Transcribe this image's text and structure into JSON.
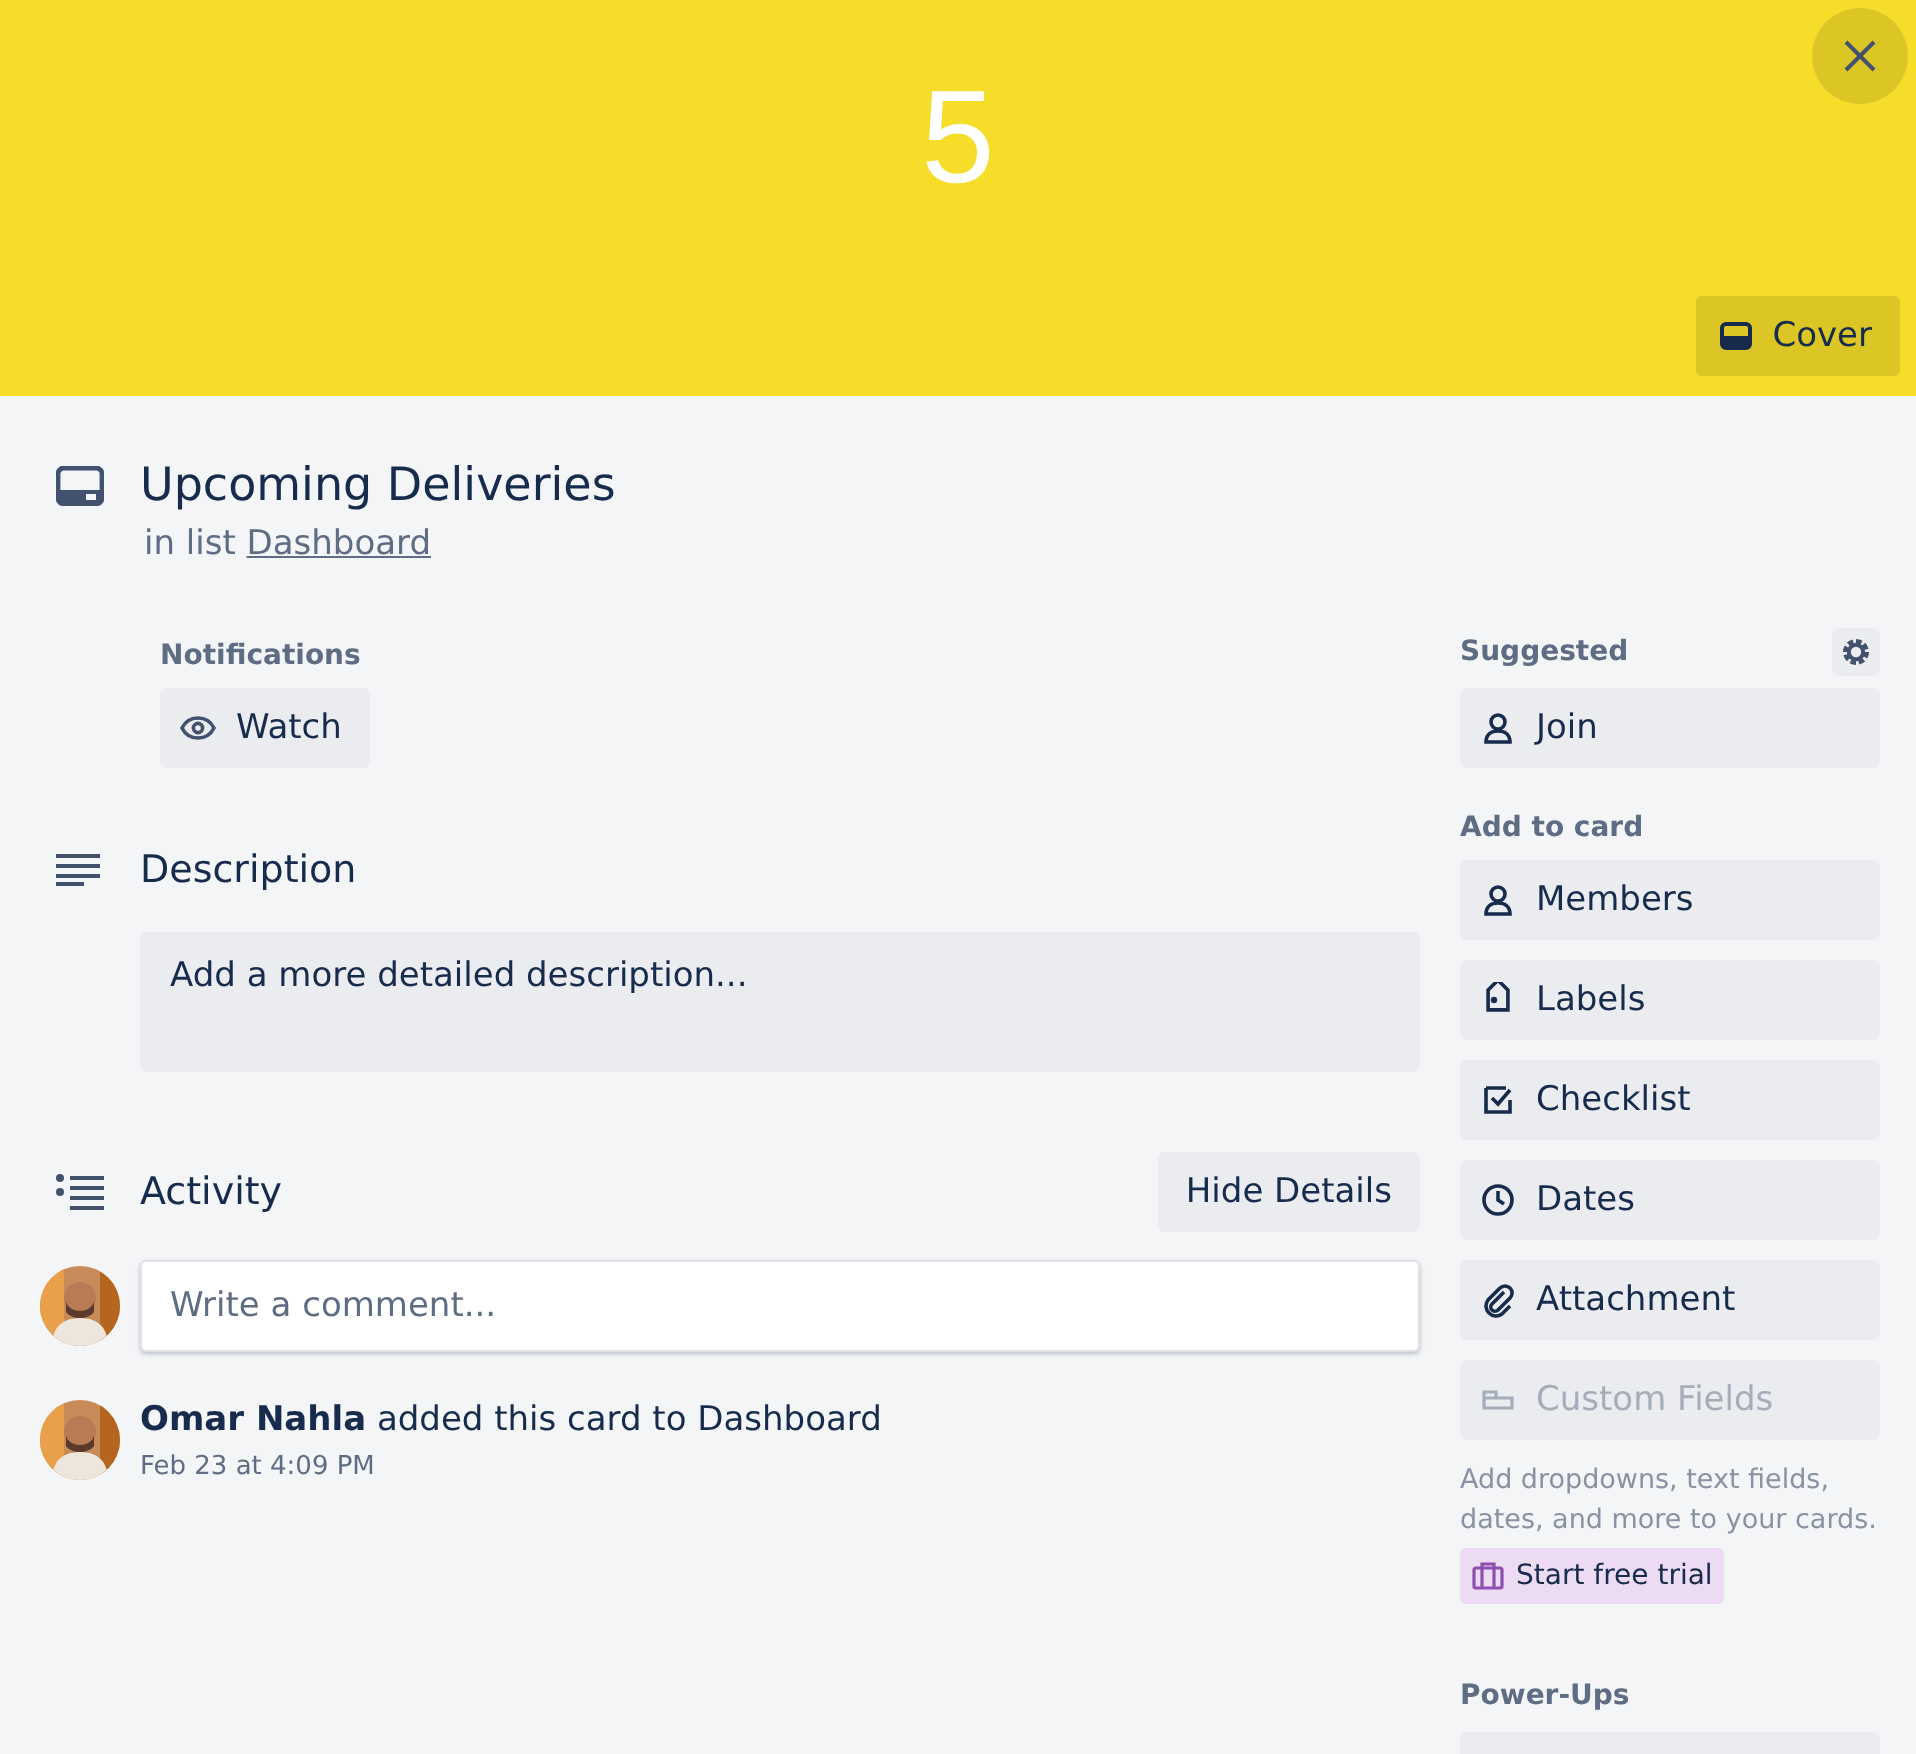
{
  "cover": {
    "title": "5",
    "cover_button": "Cover"
  },
  "card": {
    "title": "Upcoming Deliveries",
    "list_prefix": "in list",
    "list_name": "Dashboard"
  },
  "notifications": {
    "label": "Notifications",
    "watch_button": "Watch"
  },
  "description": {
    "heading": "Description",
    "placeholder": "Add a more detailed description..."
  },
  "activity": {
    "heading": "Activity",
    "toggle_button": "Hide Details",
    "comment_placeholder": "Write a comment...",
    "entries": [
      {
        "author": "Omar Nahla",
        "action": "added this card to Dashboard",
        "time": "Feb 23 at 4:09 PM"
      }
    ]
  },
  "sidebar": {
    "suggested_label": "Suggested",
    "suggested": [
      {
        "kind": "join",
        "label": "Join",
        "disabled": false
      }
    ],
    "add_label": "Add to card",
    "add_items": [
      {
        "kind": "members",
        "label": "Members",
        "disabled": false
      },
      {
        "kind": "labels",
        "label": "Labels",
        "disabled": false
      },
      {
        "kind": "checklist",
        "label": "Checklist",
        "disabled": false
      },
      {
        "kind": "dates",
        "label": "Dates",
        "disabled": false
      },
      {
        "kind": "attachment",
        "label": "Attachment",
        "disabled": false
      },
      {
        "kind": "fields",
        "label": "Custom Fields",
        "disabled": true
      }
    ],
    "upsell_text": "Add dropdowns, text fields, dates, and more to your cards.",
    "trial_button": "Start free trial",
    "powerups_label": "Power-Ups"
  }
}
